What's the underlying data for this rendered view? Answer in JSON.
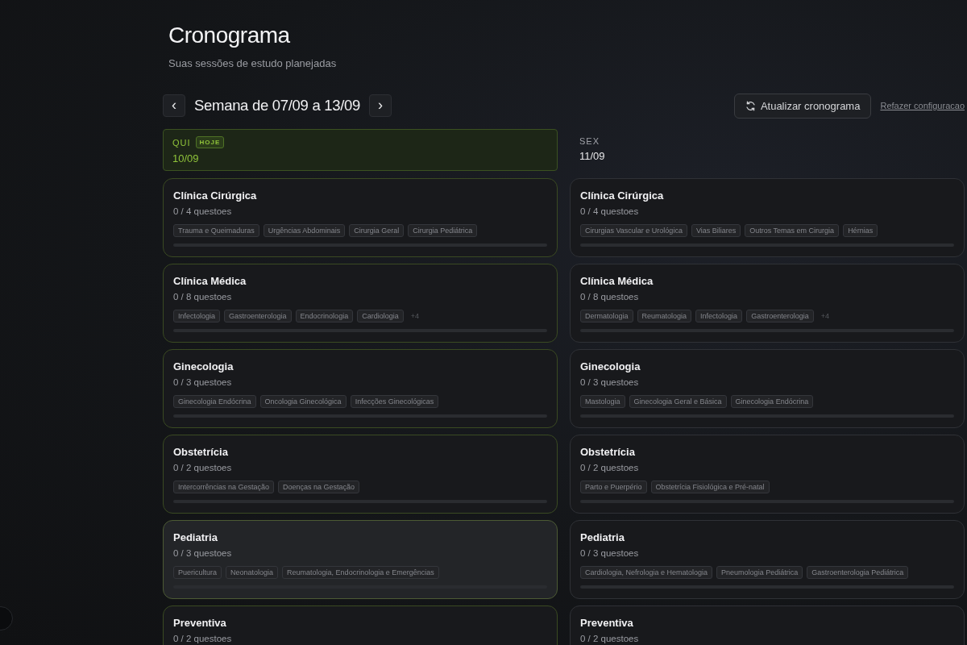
{
  "header": {
    "title": "Cronograma",
    "subtitle": "Suas sessões de estudo planejadas"
  },
  "week_nav": {
    "prev": "‹",
    "label": "Semana de 07/09 a 13/09",
    "next": "›"
  },
  "actions": {
    "refresh_button": "Atualizar cronograma",
    "redo_link": "Refazer configuracao"
  },
  "days": [
    {
      "weekday": "QUI",
      "badge": "HOJE",
      "date": "10/09",
      "today": true,
      "cards": [
        {
          "title": "Clínica Cirúrgica",
          "progress": "0 / 4 questoes",
          "level": 0,
          "highlighted": false,
          "topics": [
            "Trauma e Queimaduras",
            "Urgências Abdominais",
            "Cirurgia Geral",
            "Cirurgia Pediátrica"
          ]
        },
        {
          "title": "Clínica Médica",
          "progress": "0 / 8 questoes",
          "level": 0,
          "highlighted": false,
          "topics": [
            "Infectologia",
            "Gastroenterologia",
            "Endocrinologia",
            "Cardiologia"
          ],
          "more": "+4"
        },
        {
          "title": "Ginecologia",
          "progress": "0 / 3 questoes",
          "level": 0,
          "highlighted": false,
          "topics": [
            "Ginecologia Endócrina",
            "Oncologia Ginecológica",
            "Infecções Ginecológicas"
          ]
        },
        {
          "title": "Obstetrícia",
          "progress": "0 / 2 questoes",
          "level": 0,
          "highlighted": false,
          "topics": [
            "Intercorrências na Gestação",
            "Doenças na Gestação"
          ]
        },
        {
          "title": "Pediatria",
          "progress": "0 / 3 questoes",
          "level": 0,
          "highlighted": true,
          "topics": [
            "Puericultura",
            "Neonatologia",
            "Reumatologia, Endocrinologia e Emergências"
          ]
        },
        {
          "title": "Preventiva",
          "progress": "0 / 2 questoes",
          "highlighted": false
        }
      ]
    },
    {
      "weekday": "SEX",
      "date": "11/09",
      "today": false,
      "cards": [
        {
          "title": "Clínica Cirúrgica",
          "progress": "0 / 4 questoes",
          "level": 0,
          "highlighted": false,
          "topics": [
            "Cirurgias Vascular e Urológica",
            "Vias Biliares",
            "Outros Temas em Cirurgia",
            "Hérnias"
          ]
        },
        {
          "title": "Clínica Médica",
          "progress": "0 / 8 questoes",
          "level": 0,
          "highlighted": false,
          "topics": [
            "Dermatologia",
            "Reumatologia",
            "Infectologia",
            "Gastroenterologia"
          ],
          "more": "+4"
        },
        {
          "title": "Ginecologia",
          "progress": "0 / 3 questoes",
          "level": 0,
          "highlighted": false,
          "topics": [
            "Mastologia",
            "Ginecologia Geral e Básica",
            "Ginecologia Endócrina"
          ]
        },
        {
          "title": "Obstetrícia",
          "progress": "0 / 2 questoes",
          "level": 0,
          "highlighted": false,
          "topics": [
            "Parto e Puerpério",
            "Obstetrícia Fisiológica e Pré-natal"
          ]
        },
        {
          "title": "Pediatria",
          "progress": "0 / 3 questoes",
          "level": 0,
          "highlighted": false,
          "topics": [
            "Cardiologia, Nefrologia e Hematologia",
            "Pneumologia Pediátrica",
            "Gastroenterologia Pediátrica"
          ]
        },
        {
          "title": "Preventiva",
          "progress": "0 / 2 questoes",
          "highlighted": false
        }
      ]
    }
  ]
}
